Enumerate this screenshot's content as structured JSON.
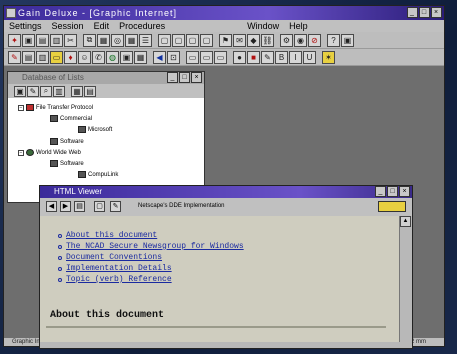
{
  "app": {
    "title": "Gain Deluxe - [Graphic Internet]"
  },
  "menu": {
    "items": [
      {
        "label": "Settings",
        "enabled": true
      },
      {
        "label": "Session",
        "enabled": true
      },
      {
        "label": "Edit",
        "enabled": true
      },
      {
        "label": "Procedures",
        "enabled": true
      },
      {
        "label": "Window",
        "enabled": true
      },
      {
        "label": "Help",
        "enabled": true
      }
    ]
  },
  "tree_window": {
    "title": "Database of Lists",
    "nodes": [
      {
        "label": "File Transfer Protocol"
      },
      {
        "label": "Commercial"
      },
      {
        "label": "Microsoft"
      },
      {
        "label": "Software"
      },
      {
        "label": "World Wide Web"
      },
      {
        "label": "Software"
      },
      {
        "label": "CompuLink"
      }
    ]
  },
  "viewer": {
    "title": "HTML Viewer",
    "dde_label": "Netscape's DDE Implementation",
    "links": [
      "About this document",
      "The NCAD Secure Newsgroup for Windows",
      "Document Conventions",
      "Implementation Details",
      "Topic (verb) Reference"
    ],
    "heading": "About this document"
  },
  "status": {
    "left": "Graphic Internet mode",
    "right": "RSI  522 mm"
  },
  "colors": {
    "titlebar": "#3b2a9a",
    "link": "#1a2aa0",
    "viewer_bg": "#cfcdbf"
  }
}
